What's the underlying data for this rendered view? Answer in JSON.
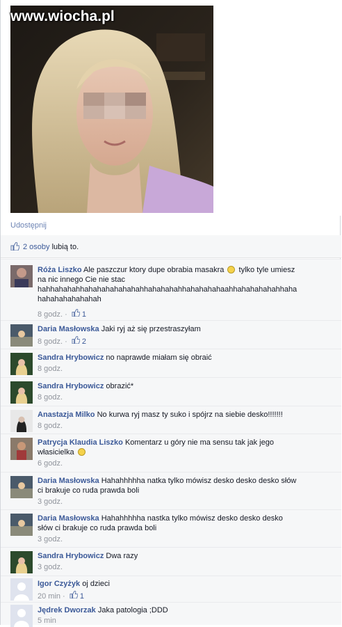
{
  "watermark": "www.wiocha.pl",
  "share_label": "Udostępnij",
  "likes": {
    "count_text": "2 osoby",
    "rest_text": "lubią to."
  },
  "comments": [
    {
      "author": "Róża Liszko",
      "line1": "Ale paszczur ktory dupe obrabia masakra",
      "line1b": "tylko tyle umiesz",
      "line2": "na nic innego Cie nie stac",
      "line3": "hahhahahahhahahahahahahahhahahahahhahahahahaahhahahahahahhaha",
      "line4": "hahahahahahahah",
      "time": "8 godz.",
      "likes": "1"
    },
    {
      "author": "Daria Masłowska",
      "text": "Jaki ryj aż się przestraszyłam",
      "time": "8 godz.",
      "likes": "2"
    },
    {
      "author": "Sandra Hrybowicz",
      "text": "no naprawde miałam się obraić",
      "time": "8 godz."
    },
    {
      "author": "Sandra Hrybowicz",
      "text": "obrazić*",
      "time": "8 godz."
    },
    {
      "author": "Anastazja Milko",
      "text": "No kurwa ryj masz ty suko i spójrz na siebie desko!!!!!!!",
      "time": "8 godz."
    },
    {
      "author": "Patrycja Klaudia Liszko",
      "line1": "Komentarz u góry nie ma sensu tak jak jego",
      "line2": "własicielka",
      "time": "6 godz."
    },
    {
      "author": "Daria Masłowska",
      "line1": "Hahahhhhha natka tylko mówisz desko desko desko słów",
      "line2": "ci brakuje co ruda prawda boli",
      "time": "3 godz."
    },
    {
      "author": "Daria Masłowska",
      "line1": "Hahahhhhha nastka tylko mówisz desko desko desko",
      "line2": "słów ci brakuje co ruda prawda boli",
      "time": "3 godz."
    },
    {
      "author": "Sandra Hrybowicz",
      "text": "Dwa razy",
      "time": "3 godz."
    },
    {
      "author": "Igor Czyżyk",
      "text": "oj dzieci",
      "time": "20 min",
      "likes": "1"
    },
    {
      "author": "Jędrek Dworzak",
      "text": "Jaka patologia ;DDD",
      "time": "5 min"
    }
  ]
}
